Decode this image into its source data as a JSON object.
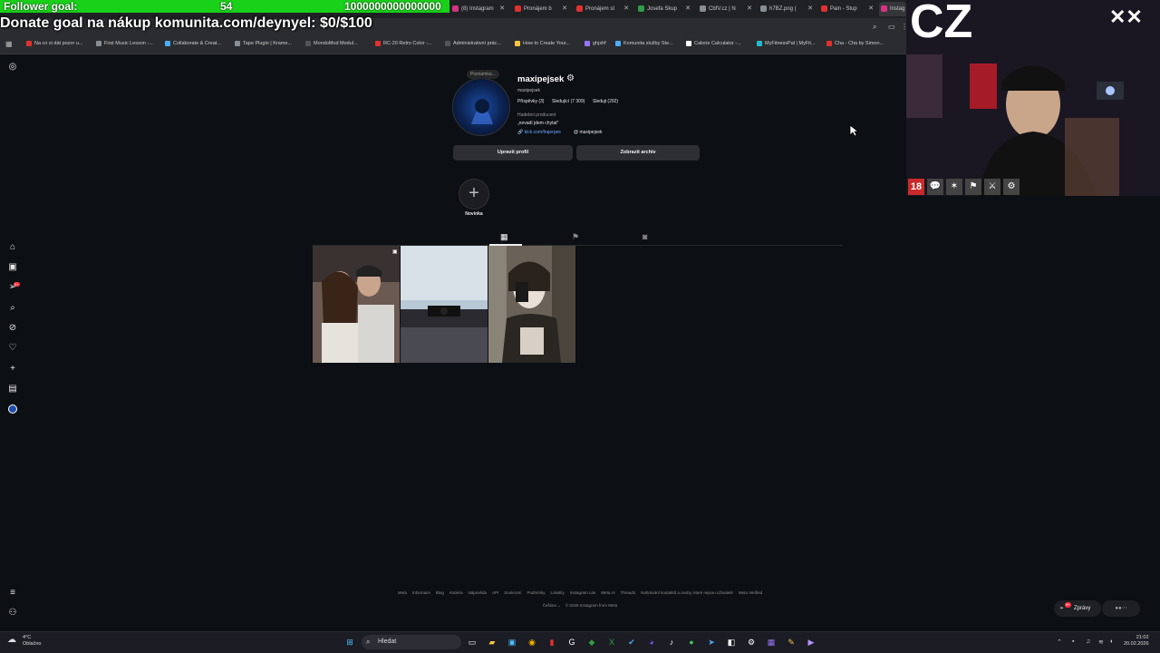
{
  "overlay": {
    "follower_label": "Follower goal:",
    "follower_count": "54",
    "follower_target": "1000000000000000",
    "donate_text": "Donate goal na nákup komunita.com/deynyel: $0/$100",
    "cam_text": "CZ"
  },
  "browser": {
    "tabs": [
      {
        "label": "(8) Instagram",
        "color": "#d63384"
      },
      {
        "label": "Pronájem b",
        "color": "#e03131"
      },
      {
        "label": "Pronájem st",
        "color": "#e03131"
      },
      {
        "label": "Josefa Skup",
        "color": "#2f9e44"
      },
      {
        "label": "CbfV.cz | N",
        "color": "#868e96"
      },
      {
        "label": "h7BZ.png (",
        "color": "#868e96"
      },
      {
        "label": "Pain - Stup",
        "color": "#e03131"
      },
      {
        "label": "Instag",
        "color": "#d63384"
      }
    ],
    "bookmarks": [
      "Na co si dát pozor u...",
      "First Music Lesson -...",
      "Collaborate & Creat...",
      "Tape Plugin | Krame...",
      "MondoMod Modul...",
      "RC-20 Retro Color -...",
      "Administrativní prác...",
      "How to Create Your...",
      "ghjshf",
      "Komunita služby Ste...",
      "Calorie Calculator -...",
      "MyFitnessPal | MyFit...",
      "Cha - Cha by Simon..."
    ]
  },
  "profile": {
    "note": "Poznámka...",
    "username": "maxipejsek",
    "handle": "maxipejsek",
    "posts": "Příspěvky (3)",
    "followers": "Sledující (7 309)",
    "following": "Sleduji (292)",
    "category": "Hudební producent",
    "bio": "„nevadí jdem chytat\"",
    "link": "kick.com/frajerpes",
    "threads": "maxipejsek",
    "edit_button": "Upravit profil",
    "archive_button": "Zobrazit archiv",
    "highlight_label": "Novinka",
    "notification_badge": "9+"
  },
  "footer": {
    "links": [
      "Meta",
      "Informace",
      "Blog",
      "Kariéra",
      "Nápověda",
      "API",
      "Soukromí",
      "Podmínky",
      "Lokality",
      "Instagram Lite",
      "Meta AI",
      "Threads",
      "Nahrávání kontaktů a osoby, které nejsou uživatelé",
      "Meta Verified"
    ],
    "language": "Čeština ⌄",
    "copyright": "© 2026 Instagram from Meta",
    "messages": "Zprávy",
    "messages_badge": "9+"
  },
  "taskbar": {
    "temp": "4°C",
    "weather": "Oblačno",
    "search": "Hledat",
    "time": "21:02",
    "date": "20.02.2026"
  },
  "colors": {
    "follower_bar": "#19d119",
    "instagram_bg": "#0c0f14",
    "link": "#6aa9ff"
  }
}
